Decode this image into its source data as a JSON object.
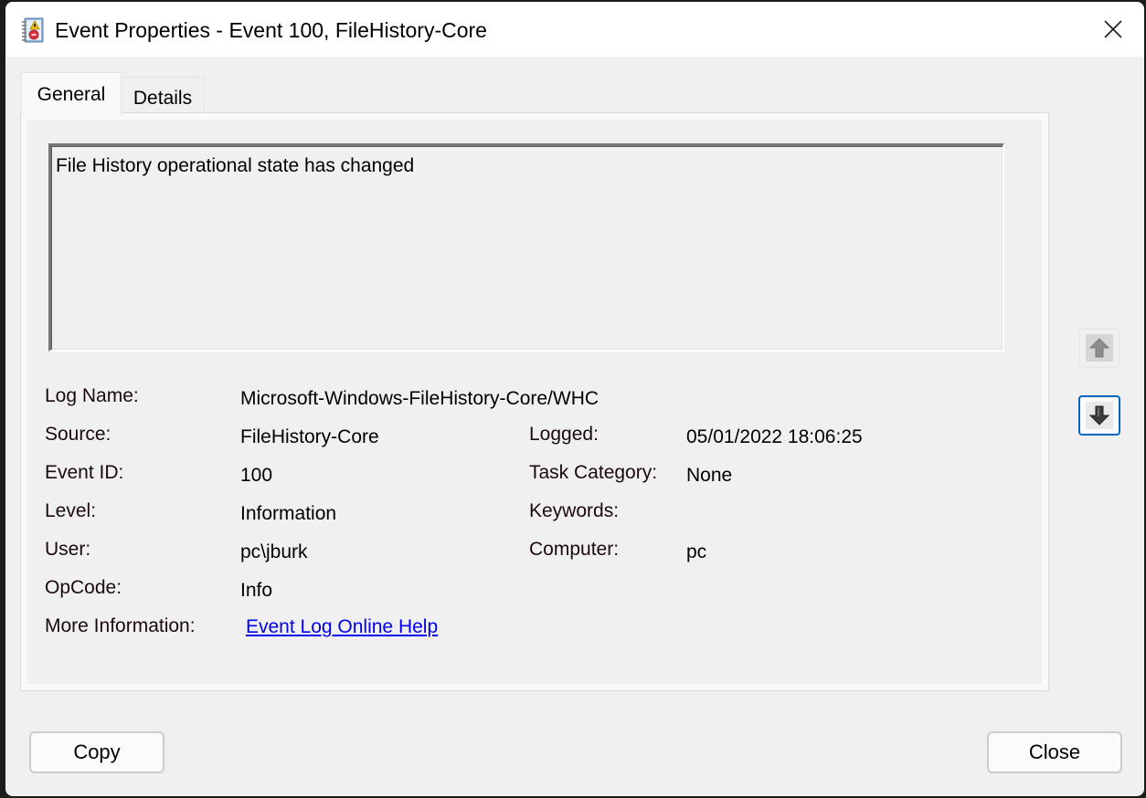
{
  "window": {
    "title": "Event Properties - Event 100, FileHistory-Core",
    "icon": "event-viewer-icon",
    "close_icon": "close-icon"
  },
  "tabs": [
    {
      "label": "General",
      "active": true
    },
    {
      "label": "Details",
      "active": false
    }
  ],
  "general": {
    "description": "File History operational state has changed",
    "fields_left": [
      {
        "label": "Log Name:",
        "value": "Microsoft-Windows-FileHistory-Core/WHC"
      },
      {
        "label": "Source:",
        "value": "FileHistory-Core"
      },
      {
        "label": "Event ID:",
        "value": "100"
      },
      {
        "label": "Level:",
        "value": "Information"
      },
      {
        "label": "User:",
        "value": "pc\\jburk"
      },
      {
        "label": "OpCode:",
        "value": "Info"
      },
      {
        "label": "More Information:",
        "value": "Event Log Online Help",
        "is_link": true
      }
    ],
    "fields_right": [
      {
        "label": "Logged:",
        "value": "05/01/2022 18:06:25"
      },
      {
        "label": "Task Category:",
        "value": "None"
      },
      {
        "label": "Keywords:",
        "value": ""
      },
      {
        "label": "Computer:",
        "value": "pc"
      }
    ]
  },
  "nav": {
    "up_icon": "arrow-up-icon",
    "down_icon": "arrow-down-icon",
    "up_enabled": false,
    "down_enabled": true
  },
  "buttons": {
    "copy_label": "Copy",
    "close_label": "Close"
  },
  "colors": {
    "link": "#0000ee",
    "focus_border": "#0067c0",
    "dialog_bg": "#f0f0f0",
    "titlebar_bg": "#ffffff"
  }
}
